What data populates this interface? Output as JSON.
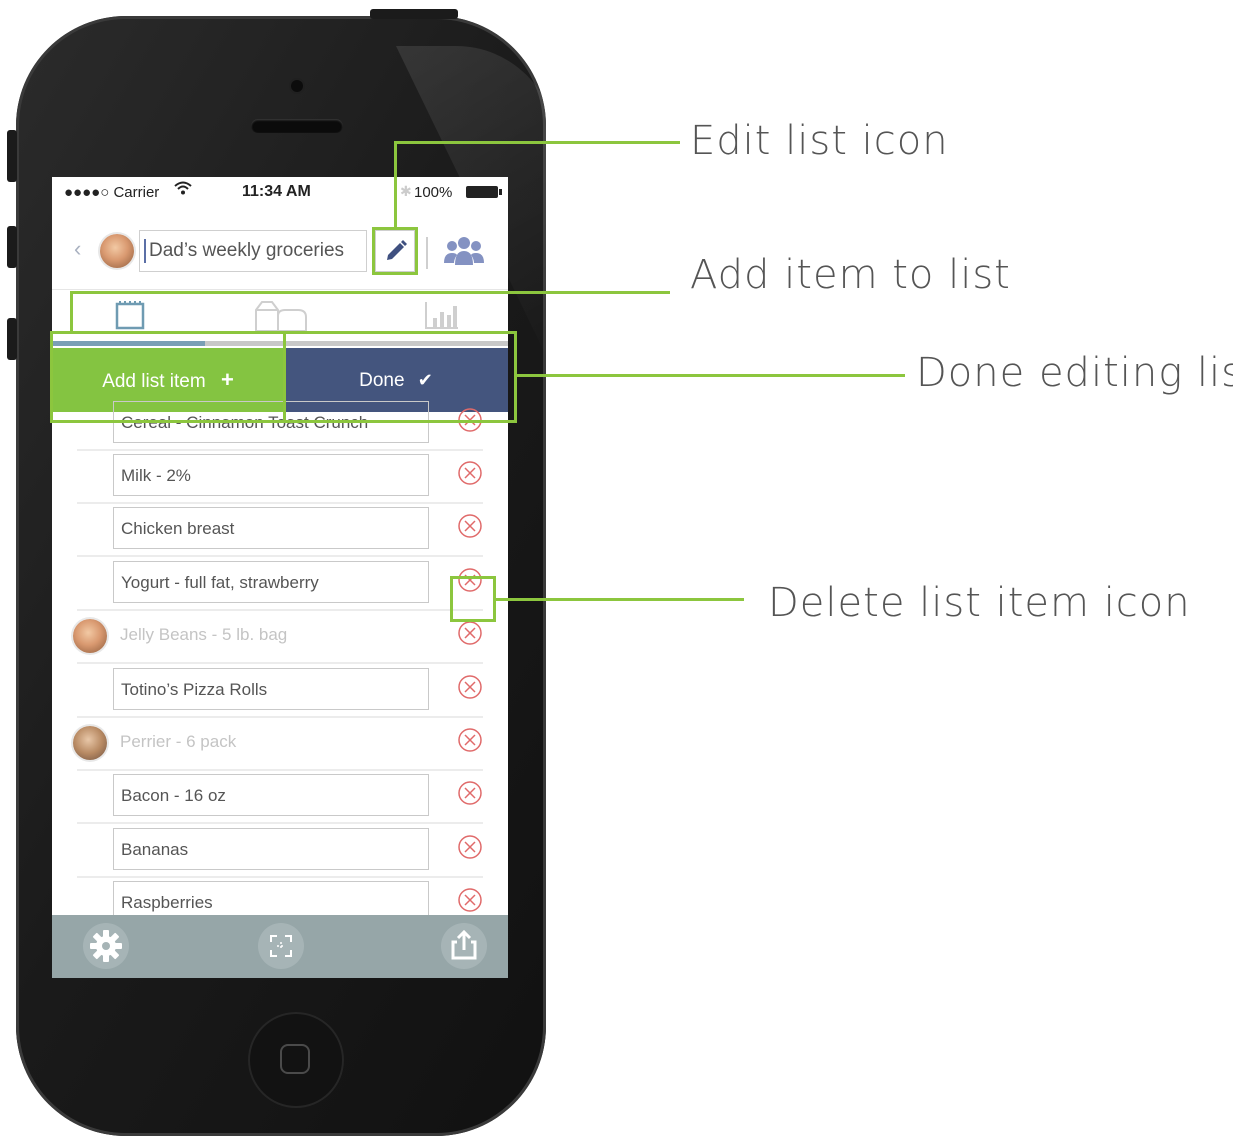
{
  "status_bar": {
    "carrier": "●●●●○ Carrier",
    "time": "11:34 AM",
    "battery": "100%"
  },
  "header": {
    "list_title": "Dad’s weekly groceries"
  },
  "actions": {
    "add_label": "Add list item",
    "done_label": "Done"
  },
  "list_items": [
    {
      "text": "Cereal - Cinnamon Toast Crunch"
    },
    {
      "text": "Milk - 2%"
    },
    {
      "text": "Chicken breast"
    },
    {
      "text": "Yogurt - full fat, strawberry"
    },
    {
      "text": "Jelly Beans - 5 lb. bag"
    },
    {
      "text": "Totino’s Pizza Rolls"
    },
    {
      "text": "Perrier - 6 pack"
    },
    {
      "text": "Bacon - 16 oz"
    },
    {
      "text": "Bananas"
    },
    {
      "text": "Raspberries"
    }
  ],
  "annotations": {
    "edit": "Edit list icon",
    "add": "Add item to list",
    "done": "Done editing list",
    "delete": "Delete list item icon"
  },
  "colors": {
    "accent_green": "#84c441",
    "done_blue": "#44557e",
    "delete_red": "#e06a6a",
    "bottom_bar": "#96a6a8"
  }
}
